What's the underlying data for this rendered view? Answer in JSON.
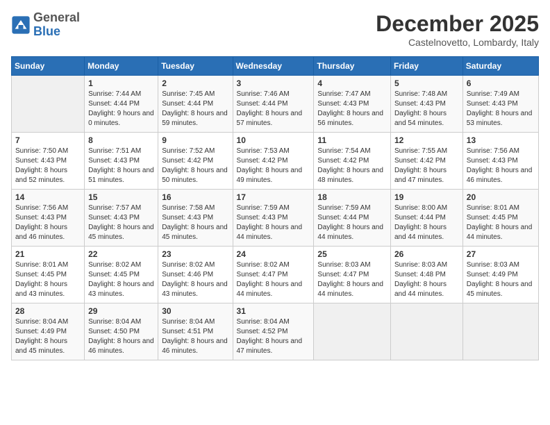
{
  "logo": {
    "general": "General",
    "blue": "Blue"
  },
  "header": {
    "month": "December 2025",
    "location": "Castelnovetto, Lombardy, Italy"
  },
  "weekdays": [
    "Sunday",
    "Monday",
    "Tuesday",
    "Wednesday",
    "Thursday",
    "Friday",
    "Saturday"
  ],
  "weeks": [
    [
      {
        "day": "",
        "sunrise": "",
        "sunset": "",
        "daylight": ""
      },
      {
        "day": "1",
        "sunrise": "Sunrise: 7:44 AM",
        "sunset": "Sunset: 4:44 PM",
        "daylight": "Daylight: 9 hours and 0 minutes."
      },
      {
        "day": "2",
        "sunrise": "Sunrise: 7:45 AM",
        "sunset": "Sunset: 4:44 PM",
        "daylight": "Daylight: 8 hours and 59 minutes."
      },
      {
        "day": "3",
        "sunrise": "Sunrise: 7:46 AM",
        "sunset": "Sunset: 4:44 PM",
        "daylight": "Daylight: 8 hours and 57 minutes."
      },
      {
        "day": "4",
        "sunrise": "Sunrise: 7:47 AM",
        "sunset": "Sunset: 4:43 PM",
        "daylight": "Daylight: 8 hours and 56 minutes."
      },
      {
        "day": "5",
        "sunrise": "Sunrise: 7:48 AM",
        "sunset": "Sunset: 4:43 PM",
        "daylight": "Daylight: 8 hours and 54 minutes."
      },
      {
        "day": "6",
        "sunrise": "Sunrise: 7:49 AM",
        "sunset": "Sunset: 4:43 PM",
        "daylight": "Daylight: 8 hours and 53 minutes."
      }
    ],
    [
      {
        "day": "7",
        "sunrise": "Sunrise: 7:50 AM",
        "sunset": "Sunset: 4:43 PM",
        "daylight": "Daylight: 8 hours and 52 minutes."
      },
      {
        "day": "8",
        "sunrise": "Sunrise: 7:51 AM",
        "sunset": "Sunset: 4:43 PM",
        "daylight": "Daylight: 8 hours and 51 minutes."
      },
      {
        "day": "9",
        "sunrise": "Sunrise: 7:52 AM",
        "sunset": "Sunset: 4:42 PM",
        "daylight": "Daylight: 8 hours and 50 minutes."
      },
      {
        "day": "10",
        "sunrise": "Sunrise: 7:53 AM",
        "sunset": "Sunset: 4:42 PM",
        "daylight": "Daylight: 8 hours and 49 minutes."
      },
      {
        "day": "11",
        "sunrise": "Sunrise: 7:54 AM",
        "sunset": "Sunset: 4:42 PM",
        "daylight": "Daylight: 8 hours and 48 minutes."
      },
      {
        "day": "12",
        "sunrise": "Sunrise: 7:55 AM",
        "sunset": "Sunset: 4:42 PM",
        "daylight": "Daylight: 8 hours and 47 minutes."
      },
      {
        "day": "13",
        "sunrise": "Sunrise: 7:56 AM",
        "sunset": "Sunset: 4:43 PM",
        "daylight": "Daylight: 8 hours and 46 minutes."
      }
    ],
    [
      {
        "day": "14",
        "sunrise": "Sunrise: 7:56 AM",
        "sunset": "Sunset: 4:43 PM",
        "daylight": "Daylight: 8 hours and 46 minutes."
      },
      {
        "day": "15",
        "sunrise": "Sunrise: 7:57 AM",
        "sunset": "Sunset: 4:43 PM",
        "daylight": "Daylight: 8 hours and 45 minutes."
      },
      {
        "day": "16",
        "sunrise": "Sunrise: 7:58 AM",
        "sunset": "Sunset: 4:43 PM",
        "daylight": "Daylight: 8 hours and 45 minutes."
      },
      {
        "day": "17",
        "sunrise": "Sunrise: 7:59 AM",
        "sunset": "Sunset: 4:43 PM",
        "daylight": "Daylight: 8 hours and 44 minutes."
      },
      {
        "day": "18",
        "sunrise": "Sunrise: 7:59 AM",
        "sunset": "Sunset: 4:44 PM",
        "daylight": "Daylight: 8 hours and 44 minutes."
      },
      {
        "day": "19",
        "sunrise": "Sunrise: 8:00 AM",
        "sunset": "Sunset: 4:44 PM",
        "daylight": "Daylight: 8 hours and 44 minutes."
      },
      {
        "day": "20",
        "sunrise": "Sunrise: 8:01 AM",
        "sunset": "Sunset: 4:45 PM",
        "daylight": "Daylight: 8 hours and 44 minutes."
      }
    ],
    [
      {
        "day": "21",
        "sunrise": "Sunrise: 8:01 AM",
        "sunset": "Sunset: 4:45 PM",
        "daylight": "Daylight: 8 hours and 43 minutes."
      },
      {
        "day": "22",
        "sunrise": "Sunrise: 8:02 AM",
        "sunset": "Sunset: 4:45 PM",
        "daylight": "Daylight: 8 hours and 43 minutes."
      },
      {
        "day": "23",
        "sunrise": "Sunrise: 8:02 AM",
        "sunset": "Sunset: 4:46 PM",
        "daylight": "Daylight: 8 hours and 43 minutes."
      },
      {
        "day": "24",
        "sunrise": "Sunrise: 8:02 AM",
        "sunset": "Sunset: 4:47 PM",
        "daylight": "Daylight: 8 hours and 44 minutes."
      },
      {
        "day": "25",
        "sunrise": "Sunrise: 8:03 AM",
        "sunset": "Sunset: 4:47 PM",
        "daylight": "Daylight: 8 hours and 44 minutes."
      },
      {
        "day": "26",
        "sunrise": "Sunrise: 8:03 AM",
        "sunset": "Sunset: 4:48 PM",
        "daylight": "Daylight: 8 hours and 44 minutes."
      },
      {
        "day": "27",
        "sunrise": "Sunrise: 8:03 AM",
        "sunset": "Sunset: 4:49 PM",
        "daylight": "Daylight: 8 hours and 45 minutes."
      }
    ],
    [
      {
        "day": "28",
        "sunrise": "Sunrise: 8:04 AM",
        "sunset": "Sunset: 4:49 PM",
        "daylight": "Daylight: 8 hours and 45 minutes."
      },
      {
        "day": "29",
        "sunrise": "Sunrise: 8:04 AM",
        "sunset": "Sunset: 4:50 PM",
        "daylight": "Daylight: 8 hours and 46 minutes."
      },
      {
        "day": "30",
        "sunrise": "Sunrise: 8:04 AM",
        "sunset": "Sunset: 4:51 PM",
        "daylight": "Daylight: 8 hours and 46 minutes."
      },
      {
        "day": "31",
        "sunrise": "Sunrise: 8:04 AM",
        "sunset": "Sunset: 4:52 PM",
        "daylight": "Daylight: 8 hours and 47 minutes."
      },
      {
        "day": "",
        "sunrise": "",
        "sunset": "",
        "daylight": ""
      },
      {
        "day": "",
        "sunrise": "",
        "sunset": "",
        "daylight": ""
      },
      {
        "day": "",
        "sunrise": "",
        "sunset": "",
        "daylight": ""
      }
    ]
  ]
}
